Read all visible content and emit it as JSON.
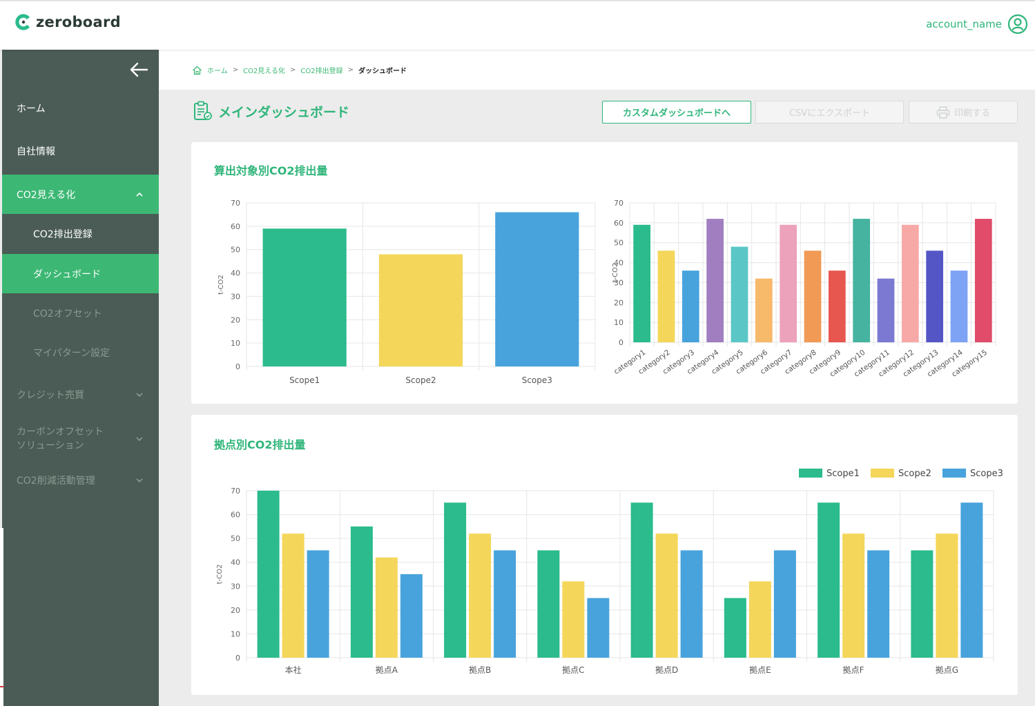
{
  "header": {
    "brand": "zeroboard",
    "account_name": "account_name"
  },
  "sidebar": {
    "items": [
      {
        "label": "ホーム",
        "state": "normal"
      },
      {
        "label": "自社情報",
        "state": "normal"
      },
      {
        "label": "CO2見える化",
        "state": "active",
        "chevron": "chevron-up-icon"
      },
      {
        "label": "CO2排出登録",
        "state": "sub"
      },
      {
        "label": "ダッシュボード",
        "state": "sub-active"
      },
      {
        "label": "CO2オフセット",
        "state": "sub-dim"
      },
      {
        "label": "マイパターン設定",
        "state": "sub-dim"
      },
      {
        "label": "クレジット売買",
        "state": "dim",
        "chevron": "chevron-down-icon"
      },
      {
        "label": "カーボンオフセット\nソリューション",
        "line1": "カーボンオフセット",
        "line2": "ソリューション",
        "state": "dim",
        "chevron": "chevron-down-icon"
      },
      {
        "label": "CO2削減活動管理",
        "state": "dim",
        "chevron": "chevron-down-icon"
      }
    ]
  },
  "breadcrumb": {
    "home": "ホーム",
    "level1": "CO2見える化",
    "level2": "CO2排出登録",
    "current": "ダッシュボード",
    "separator": ">"
  },
  "page": {
    "title": "メインダッシュボード",
    "buttons": {
      "custom": "カスタムダッシュボードへ",
      "csv": "CSVにエクスポート",
      "print": "印刷する"
    }
  },
  "colors": {
    "accent": "#2fb57a",
    "sidebar": "#4a5c55",
    "active": "#3cb874",
    "scope1": "#2bbb8d",
    "scope2": "#f4d65a",
    "scope3": "#48a3dc"
  },
  "cards": {
    "by_target_title": "算出対象別CO2排出量",
    "by_site_title": "拠点別CO2排出量"
  },
  "chart_data": [
    {
      "type": "bar",
      "categories": [
        "Scope1",
        "Scope2",
        "Scope3"
      ],
      "values": [
        59,
        48,
        66
      ],
      "colors": [
        "#2bbb8d",
        "#f4d65a",
        "#48a3dc"
      ],
      "ylabel": "t-CO2",
      "ylim": [
        0,
        70
      ],
      "yticks": [
        0,
        10,
        20,
        30,
        40,
        50,
        60,
        70
      ],
      "grid": true
    },
    {
      "type": "bar",
      "categories": [
        "category1",
        "category2",
        "category3",
        "category4",
        "category5",
        "category6",
        "category7",
        "category8",
        "category9",
        "category10",
        "category11",
        "category12",
        "category13",
        "category14",
        "category15"
      ],
      "values": [
        59,
        46,
        36,
        62,
        48,
        32,
        59,
        46,
        36,
        62,
        32,
        59,
        46,
        36,
        62
      ],
      "colors": [
        "#2bbb8d",
        "#f4d65a",
        "#48a3dc",
        "#a07ebf",
        "#5bc6c6",
        "#f7b96a",
        "#eda2bb",
        "#f19a55",
        "#e8574f",
        "#45b3a0",
        "#7b79d1",
        "#f7a9a8",
        "#5556c6",
        "#7ea3f5",
        "#e04c6a"
      ],
      "ylabel": "t-CO2",
      "ylim": [
        0,
        70
      ],
      "yticks": [
        0,
        10,
        20,
        30,
        40,
        50,
        60,
        70
      ],
      "grid": true
    },
    {
      "type": "bar",
      "categories": [
        "本社",
        "拠点A",
        "拠点B",
        "拠点C",
        "拠点D",
        "拠点E",
        "拠点F",
        "拠点G"
      ],
      "series": [
        {
          "name": "Scope1",
          "color": "#2bbb8d",
          "values": [
            70,
            55,
            65,
            45,
            65,
            25,
            65,
            45
          ]
        },
        {
          "name": "Scope2",
          "color": "#f4d65a",
          "values": [
            52,
            42,
            52,
            32,
            52,
            32,
            52,
            52
          ]
        },
        {
          "name": "Scope3",
          "color": "#48a3dc",
          "values": [
            45,
            35,
            45,
            25,
            45,
            45,
            45,
            65
          ]
        }
      ],
      "ylabel": "t-CO2",
      "ylim": [
        0,
        70
      ],
      "yticks": [
        0,
        10,
        20,
        30,
        40,
        50,
        60,
        70
      ],
      "grid": true,
      "legend": "top-right"
    }
  ]
}
